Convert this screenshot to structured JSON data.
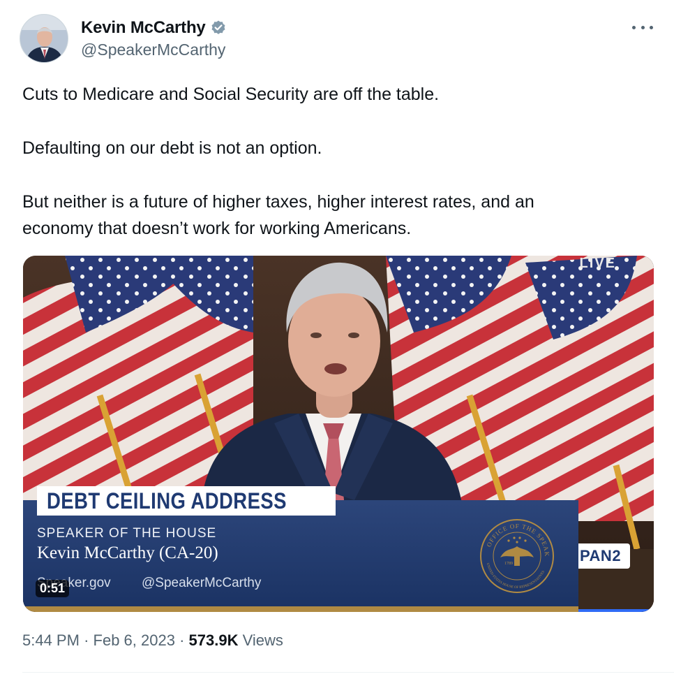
{
  "author": {
    "display_name": "Kevin McCarthy",
    "handle": "@SpeakerMcCarthy",
    "verified_color": "#829aab"
  },
  "tweet": {
    "lines": [
      "Cuts to Medicare and Social Security are off the table.",
      "Defaulting on our debt is not an option.",
      "But neither is a future of higher taxes, higher interest rates, and an",
      "economy that doesn’t work for working Americans."
    ]
  },
  "media": {
    "live_label": "LIVE",
    "headline": "DEBT CEILING ADDRESS",
    "lower_third_title": "SPEAKER OF THE HOUSE",
    "lower_third_name": "Kevin McCarthy (CA-20)",
    "lower_third_site": "Speaker.gov",
    "lower_third_social": "@SpeakerMcCarthy",
    "duration": "0:51",
    "network_partial": "PAN2",
    "seal_top_text": "OFFICE OF THE SPEAKER",
    "seal_bottom_text": "UNITED STATES HOUSE OF REPRESENTATIVES",
    "seal_year": "1789",
    "colors": {
      "banner": "#1f3a72",
      "gold": "#b08a43"
    }
  },
  "meta": {
    "time": "5:44 PM",
    "separator": "·",
    "date": "Feb 6, 2023",
    "views_count": "573.9K",
    "views_label": "Views"
  },
  "icons": {
    "more": "more-horizontal-icon",
    "verified": "verified-badge-icon"
  }
}
